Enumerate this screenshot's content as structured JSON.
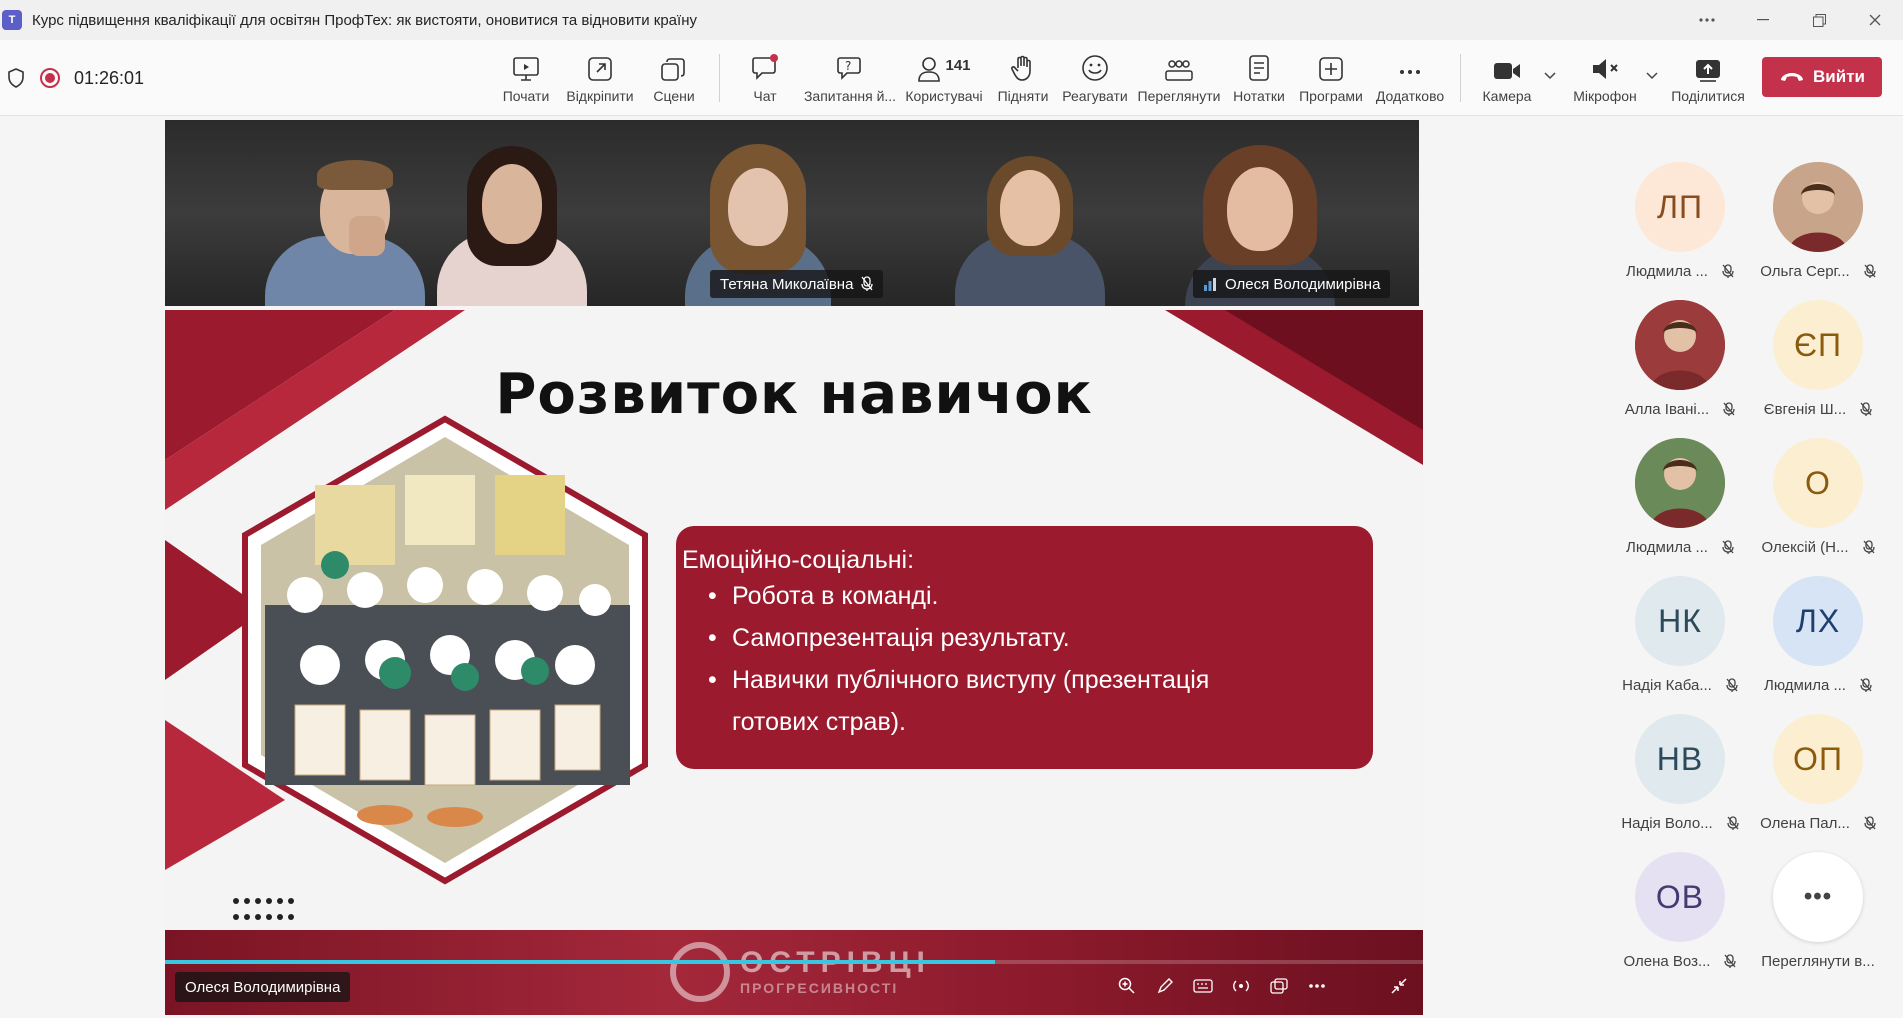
{
  "window": {
    "title": "Курс підвищення кваліфікації для освітян ПрофТех: як вистояти, оновитися та відновити країну",
    "controls": [
      "more-icon",
      "minimize-icon",
      "maximize-icon",
      "close-icon"
    ]
  },
  "toolbar": {
    "timer": "01:26:01",
    "buttons": {
      "start": "Почати",
      "open": "Відкріпити",
      "scenes": "Сцени",
      "chat": "Чат",
      "qa": "Запитання й...",
      "people": "Користувачі",
      "people_count": "141",
      "raise": "Підняти",
      "react": "Реагувати",
      "view": "Переглянути",
      "notes": "Нотатки",
      "apps": "Програми",
      "more": "Додатково",
      "camera": "Камера",
      "mic": "Мікрофон",
      "share": "Поділитися"
    },
    "leave_label": "Вийти",
    "colors": {
      "leave": "#c4314b",
      "accent": "#5b5fc7"
    }
  },
  "gallery": {
    "tags": [
      "Тетяна Миколаївна",
      "Олеся Володимирівна"
    ]
  },
  "slide": {
    "title": "Розвиток навичок",
    "box_heading": "Емоційно-соціальні:",
    "bullets": [
      "Робота в команді.",
      "Самопрезентація результату.",
      "Навички публічного виступу (презентація",
      "готових страв)."
    ],
    "brand": "ОСТРІВЦІ",
    "brand_sub": "ПРОГРЕСИВНОСТІ",
    "presenter": "Олеся Володимирівна",
    "progress": 0.66,
    "colors": {
      "box": "#9b1a2e",
      "progress": "#38c6e0"
    }
  },
  "roster": {
    "participants": [
      {
        "initials": "ЛП",
        "name": "Людмила ...",
        "bg": "#fde7d6",
        "fg": "#8a4b1f",
        "photo": false
      },
      {
        "initials": "",
        "name": "Ольга Серг...",
        "bg": "#c8a58a",
        "fg": "#000",
        "photo": true
      },
      {
        "initials": "",
        "name": "Алла Івані...",
        "bg": "#9b3b3b",
        "fg": "#000",
        "photo": true
      },
      {
        "initials": "ЄП",
        "name": "Євгенія Ш...",
        "bg": "#fcefd1",
        "fg": "#8a5a0f",
        "photo": false
      },
      {
        "initials": "",
        "name": "Людмила ...",
        "bg": "#6b8a5a",
        "fg": "#000",
        "photo": true
      },
      {
        "initials": "О",
        "name": "Олексій (Н...",
        "bg": "#fcefd1",
        "fg": "#8a5a0f",
        "photo": false
      },
      {
        "initials": "НК",
        "name": "Надія Каба...",
        "bg": "#dfe9ee",
        "fg": "#2b4a5a",
        "photo": false
      },
      {
        "initials": "ЛХ",
        "name": "Людмила ...",
        "bg": "#d6e4f5",
        "fg": "#1f3f6e",
        "photo": false
      },
      {
        "initials": "НВ",
        "name": "Надія Воло...",
        "bg": "#dfe9ee",
        "fg": "#2b4a5a",
        "photo": false
      },
      {
        "initials": "ОП",
        "name": "Олена Пал...",
        "bg": "#fcefd1",
        "fg": "#8a5a0f",
        "photo": false
      },
      {
        "initials": "ОВ",
        "name": "Олена Воз...",
        "bg": "#e6e1f2",
        "fg": "#463a73",
        "photo": false
      },
      {
        "initials": "•••",
        "name": "Переглянути в...",
        "bg": "#ffffff",
        "fg": "#444",
        "photo": false
      }
    ]
  }
}
